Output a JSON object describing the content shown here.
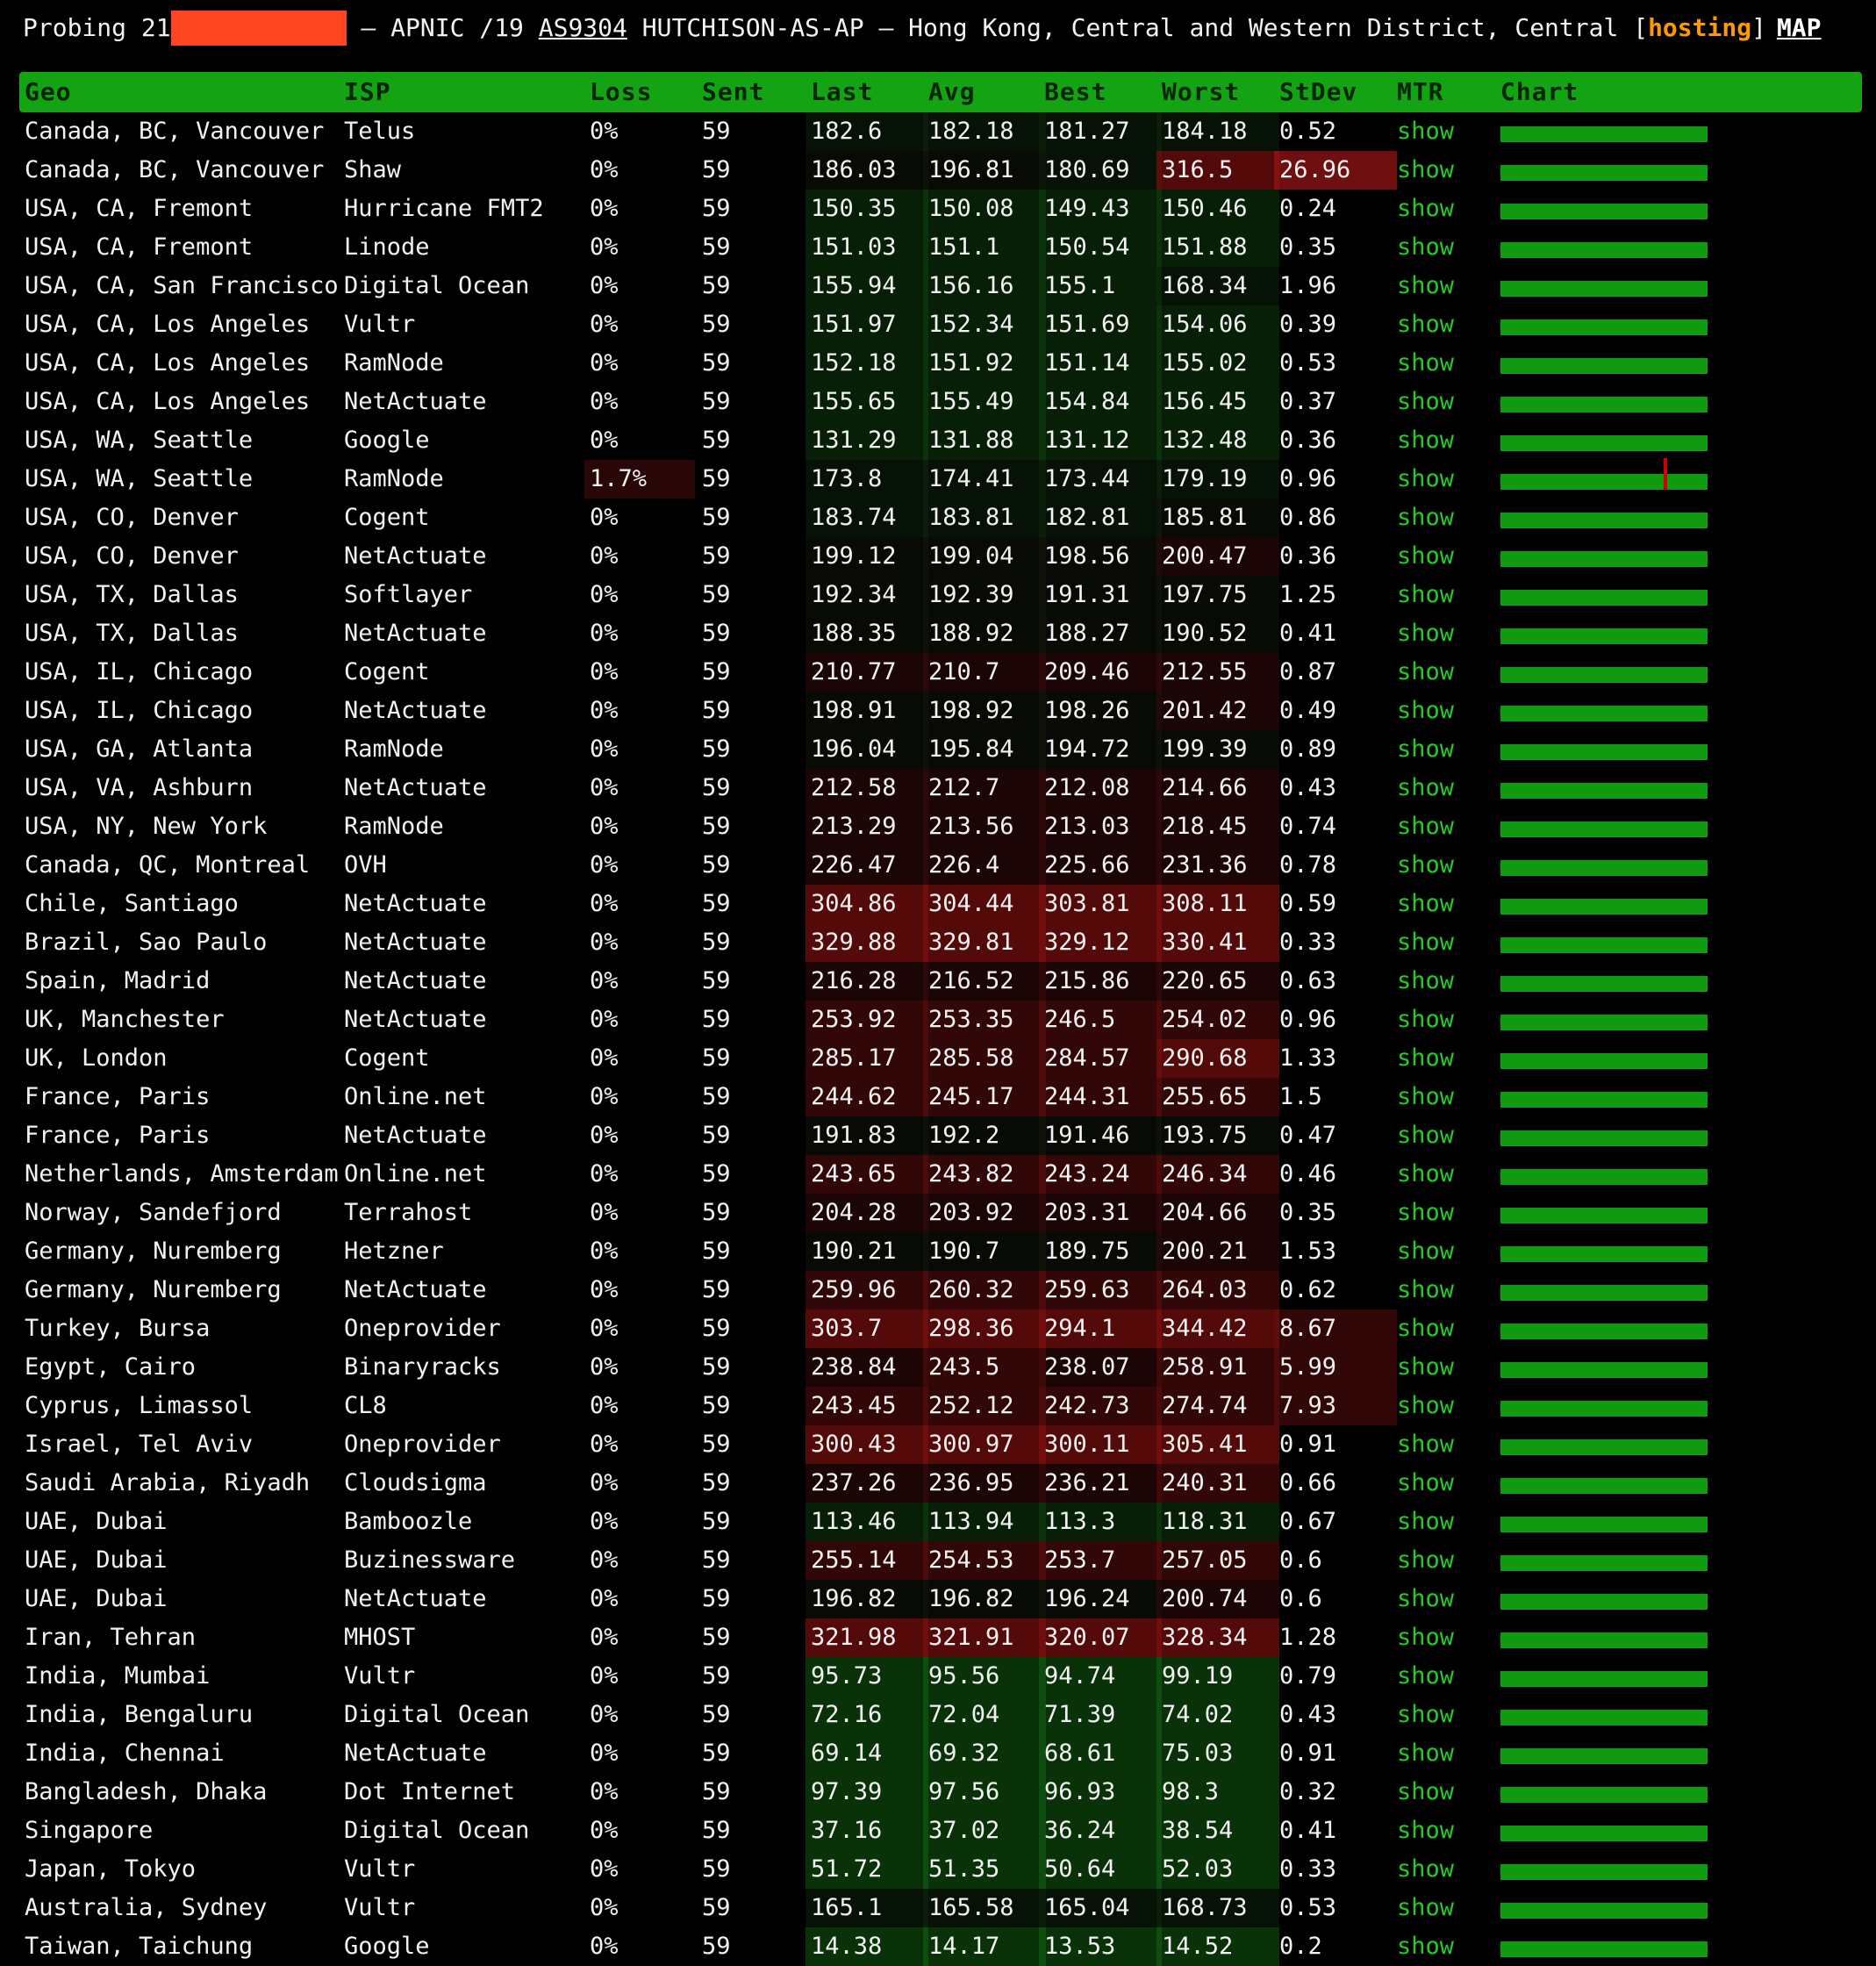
{
  "header": {
    "probing_label": "Probing 21",
    "rest": " – APNIC /19 ",
    "asn": "AS9304",
    "org": " HUTCHISON-AS-AP – Hong Kong, Central and Western District, Central [",
    "tag": "hosting",
    "close": "]",
    "map_label": "MAP"
  },
  "columns": [
    "Geo",
    "ISP",
    "Loss",
    "Sent",
    "Last",
    "Avg",
    "Best",
    "Worst",
    "StDev",
    "MTR",
    "Chart"
  ],
  "rows": [
    {
      "geo": "Canada, BC, Vancouver",
      "isp": "Telus",
      "loss": "0%",
      "sent": "59",
      "last": "182.6",
      "avg": "182.18",
      "best": "181.27",
      "worst": "184.18",
      "stdev": "0.52",
      "mtr": "show"
    },
    {
      "geo": "Canada, BC, Vancouver",
      "isp": "Shaw",
      "loss": "0%",
      "sent": "59",
      "last": "186.03",
      "avg": "196.81",
      "best": "180.69",
      "worst": "316.5",
      "stdev": "26.96",
      "mtr": "show"
    },
    {
      "geo": "USA, CA, Fremont",
      "isp": "Hurricane FMT2",
      "loss": "0%",
      "sent": "59",
      "last": "150.35",
      "avg": "150.08",
      "best": "149.43",
      "worst": "150.46",
      "stdev": "0.24",
      "mtr": "show"
    },
    {
      "geo": "USA, CA, Fremont",
      "isp": "Linode",
      "loss": "0%",
      "sent": "59",
      "last": "151.03",
      "avg": "151.1",
      "best": "150.54",
      "worst": "151.88",
      "stdev": "0.35",
      "mtr": "show"
    },
    {
      "geo": "USA, CA, San Francisco",
      "isp": "Digital Ocean",
      "loss": "0%",
      "sent": "59",
      "last": "155.94",
      "avg": "156.16",
      "best": "155.1",
      "worst": "168.34",
      "stdev": "1.96",
      "mtr": "show"
    },
    {
      "geo": "USA, CA, Los Angeles",
      "isp": "Vultr",
      "loss": "0%",
      "sent": "59",
      "last": "151.97",
      "avg": "152.34",
      "best": "151.69",
      "worst": "154.06",
      "stdev": "0.39",
      "mtr": "show"
    },
    {
      "geo": "USA, CA, Los Angeles",
      "isp": "RamNode",
      "loss": "0%",
      "sent": "59",
      "last": "152.18",
      "avg": "151.92",
      "best": "151.14",
      "worst": "155.02",
      "stdev": "0.53",
      "mtr": "show"
    },
    {
      "geo": "USA, CA, Los Angeles",
      "isp": "NetActuate",
      "loss": "0%",
      "sent": "59",
      "last": "155.65",
      "avg": "155.49",
      "best": "154.84",
      "worst": "156.45",
      "stdev": "0.37",
      "mtr": "show"
    },
    {
      "geo": "USA, WA, Seattle",
      "isp": "Google",
      "loss": "0%",
      "sent": "59",
      "last": "131.29",
      "avg": "131.88",
      "best": "131.12",
      "worst": "132.48",
      "stdev": "0.36",
      "mtr": "show"
    },
    {
      "geo": "USA, WA, Seattle",
      "isp": "RamNode",
      "loss": "1.7%",
      "sent": "59",
      "last": "173.8",
      "avg": "174.41",
      "best": "173.44",
      "worst": "179.19",
      "stdev": "0.96",
      "mtr": "show",
      "spike": 0.79
    },
    {
      "geo": "USA, CO, Denver",
      "isp": "Cogent",
      "loss": "0%",
      "sent": "59",
      "last": "183.74",
      "avg": "183.81",
      "best": "182.81",
      "worst": "185.81",
      "stdev": "0.86",
      "mtr": "show"
    },
    {
      "geo": "USA, CO, Denver",
      "isp": "NetActuate",
      "loss": "0%",
      "sent": "59",
      "last": "199.12",
      "avg": "199.04",
      "best": "198.56",
      "worst": "200.47",
      "stdev": "0.36",
      "mtr": "show"
    },
    {
      "geo": "USA, TX, Dallas",
      "isp": "Softlayer",
      "loss": "0%",
      "sent": "59",
      "last": "192.34",
      "avg": "192.39",
      "best": "191.31",
      "worst": "197.75",
      "stdev": "1.25",
      "mtr": "show"
    },
    {
      "geo": "USA, TX, Dallas",
      "isp": "NetActuate",
      "loss": "0%",
      "sent": "59",
      "last": "188.35",
      "avg": "188.92",
      "best": "188.27",
      "worst": "190.52",
      "stdev": "0.41",
      "mtr": "show"
    },
    {
      "geo": "USA, IL, Chicago",
      "isp": "Cogent",
      "loss": "0%",
      "sent": "59",
      "last": "210.77",
      "avg": "210.7",
      "best": "209.46",
      "worst": "212.55",
      "stdev": "0.87",
      "mtr": "show"
    },
    {
      "geo": "USA, IL, Chicago",
      "isp": "NetActuate",
      "loss": "0%",
      "sent": "59",
      "last": "198.91",
      "avg": "198.92",
      "best": "198.26",
      "worst": "201.42",
      "stdev": "0.49",
      "mtr": "show"
    },
    {
      "geo": "USA, GA, Atlanta",
      "isp": "RamNode",
      "loss": "0%",
      "sent": "59",
      "last": "196.04",
      "avg": "195.84",
      "best": "194.72",
      "worst": "199.39",
      "stdev": "0.89",
      "mtr": "show"
    },
    {
      "geo": "USA, VA, Ashburn",
      "isp": "NetActuate",
      "loss": "0%",
      "sent": "59",
      "last": "212.58",
      "avg": "212.7",
      "best": "212.08",
      "worst": "214.66",
      "stdev": "0.43",
      "mtr": "show"
    },
    {
      "geo": "USA, NY, New York",
      "isp": "RamNode",
      "loss": "0%",
      "sent": "59",
      "last": "213.29",
      "avg": "213.56",
      "best": "213.03",
      "worst": "218.45",
      "stdev": "0.74",
      "mtr": "show"
    },
    {
      "geo": "Canada, QC, Montreal",
      "isp": "OVH",
      "loss": "0%",
      "sent": "59",
      "last": "226.47",
      "avg": "226.4",
      "best": "225.66",
      "worst": "231.36",
      "stdev": "0.78",
      "mtr": "show"
    },
    {
      "geo": "Chile, Santiago",
      "isp": "NetActuate",
      "loss": "0%",
      "sent": "59",
      "last": "304.86",
      "avg": "304.44",
      "best": "303.81",
      "worst": "308.11",
      "stdev": "0.59",
      "mtr": "show"
    },
    {
      "geo": "Brazil, Sao Paulo",
      "isp": "NetActuate",
      "loss": "0%",
      "sent": "59",
      "last": "329.88",
      "avg": "329.81",
      "best": "329.12",
      "worst": "330.41",
      "stdev": "0.33",
      "mtr": "show"
    },
    {
      "geo": "Spain, Madrid",
      "isp": "NetActuate",
      "loss": "0%",
      "sent": "59",
      "last": "216.28",
      "avg": "216.52",
      "best": "215.86",
      "worst": "220.65",
      "stdev": "0.63",
      "mtr": "show"
    },
    {
      "geo": "UK, Manchester",
      "isp": "NetActuate",
      "loss": "0%",
      "sent": "59",
      "last": "253.92",
      "avg": "253.35",
      "best": "246.5",
      "worst": "254.02",
      "stdev": "0.96",
      "mtr": "show"
    },
    {
      "geo": "UK, London",
      "isp": "Cogent",
      "loss": "0%",
      "sent": "59",
      "last": "285.17",
      "avg": "285.58",
      "best": "284.57",
      "worst": "290.68",
      "stdev": "1.33",
      "mtr": "show"
    },
    {
      "geo": "France, Paris",
      "isp": "Online.net",
      "loss": "0%",
      "sent": "59",
      "last": "244.62",
      "avg": "245.17",
      "best": "244.31",
      "worst": "255.65",
      "stdev": "1.5",
      "mtr": "show"
    },
    {
      "geo": "France, Paris",
      "isp": "NetActuate",
      "loss": "0%",
      "sent": "59",
      "last": "191.83",
      "avg": "192.2",
      "best": "191.46",
      "worst": "193.75",
      "stdev": "0.47",
      "mtr": "show"
    },
    {
      "geo": "Netherlands, Amsterdam",
      "isp": "Online.net",
      "loss": "0%",
      "sent": "59",
      "last": "243.65",
      "avg": "243.82",
      "best": "243.24",
      "worst": "246.34",
      "stdev": "0.46",
      "mtr": "show"
    },
    {
      "geo": "Norway, Sandefjord",
      "isp": "Terrahost",
      "loss": "0%",
      "sent": "59",
      "last": "204.28",
      "avg": "203.92",
      "best": "203.31",
      "worst": "204.66",
      "stdev": "0.35",
      "mtr": "show"
    },
    {
      "geo": "Germany, Nuremberg",
      "isp": "Hetzner",
      "loss": "0%",
      "sent": "59",
      "last": "190.21",
      "avg": "190.7",
      "best": "189.75",
      "worst": "200.21",
      "stdev": "1.53",
      "mtr": "show"
    },
    {
      "geo": "Germany, Nuremberg",
      "isp": "NetActuate",
      "loss": "0%",
      "sent": "59",
      "last": "259.96",
      "avg": "260.32",
      "best": "259.63",
      "worst": "264.03",
      "stdev": "0.62",
      "mtr": "show"
    },
    {
      "geo": "Turkey, Bursa",
      "isp": "Oneprovider",
      "loss": "0%",
      "sent": "59",
      "last": "303.7",
      "avg": "298.36",
      "best": "294.1",
      "worst": "344.42",
      "stdev": "8.67",
      "mtr": "show"
    },
    {
      "geo": "Egypt, Cairo",
      "isp": "Binaryracks",
      "loss": "0%",
      "sent": "59",
      "last": "238.84",
      "avg": "243.5",
      "best": "238.07",
      "worst": "258.91",
      "stdev": "5.99",
      "mtr": "show"
    },
    {
      "geo": "Cyprus, Limassol",
      "isp": "CL8",
      "loss": "0%",
      "sent": "59",
      "last": "243.45",
      "avg": "252.12",
      "best": "242.73",
      "worst": "274.74",
      "stdev": "7.93",
      "mtr": "show"
    },
    {
      "geo": "Israel, Tel Aviv",
      "isp": "Oneprovider",
      "loss": "0%",
      "sent": "59",
      "last": "300.43",
      "avg": "300.97",
      "best": "300.11",
      "worst": "305.41",
      "stdev": "0.91",
      "mtr": "show"
    },
    {
      "geo": "Saudi Arabia, Riyadh",
      "isp": "Cloudsigma",
      "loss": "0%",
      "sent": "59",
      "last": "237.26",
      "avg": "236.95",
      "best": "236.21",
      "worst": "240.31",
      "stdev": "0.66",
      "mtr": "show"
    },
    {
      "geo": "UAE, Dubai",
      "isp": "Bamboozle",
      "loss": "0%",
      "sent": "59",
      "last": "113.46",
      "avg": "113.94",
      "best": "113.3",
      "worst": "118.31",
      "stdev": "0.67",
      "mtr": "show"
    },
    {
      "geo": "UAE, Dubai",
      "isp": "Buzinessware",
      "loss": "0%",
      "sent": "59",
      "last": "255.14",
      "avg": "254.53",
      "best": "253.7",
      "worst": "257.05",
      "stdev": "0.6",
      "mtr": "show"
    },
    {
      "geo": "UAE, Dubai",
      "isp": "NetActuate",
      "loss": "0%",
      "sent": "59",
      "last": "196.82",
      "avg": "196.82",
      "best": "196.24",
      "worst": "200.74",
      "stdev": "0.6",
      "mtr": "show"
    },
    {
      "geo": "Iran, Tehran",
      "isp": "MHOST",
      "loss": "0%",
      "sent": "59",
      "last": "321.98",
      "avg": "321.91",
      "best": "320.07",
      "worst": "328.34",
      "stdev": "1.28",
      "mtr": "show"
    },
    {
      "geo": "India, Mumbai",
      "isp": "Vultr",
      "loss": "0%",
      "sent": "59",
      "last": "95.73",
      "avg": "95.56",
      "best": "94.74",
      "worst": "99.19",
      "stdev": "0.79",
      "mtr": "show"
    },
    {
      "geo": "India, Bengaluru",
      "isp": "Digital Ocean",
      "loss": "0%",
      "sent": "59",
      "last": "72.16",
      "avg": "72.04",
      "best": "71.39",
      "worst": "74.02",
      "stdev": "0.43",
      "mtr": "show"
    },
    {
      "geo": "India, Chennai",
      "isp": "NetActuate",
      "loss": "0%",
      "sent": "59",
      "last": "69.14",
      "avg": "69.32",
      "best": "68.61",
      "worst": "75.03",
      "stdev": "0.91",
      "mtr": "show"
    },
    {
      "geo": "Bangladesh, Dhaka",
      "isp": "Dot Internet",
      "loss": "0%",
      "sent": "59",
      "last": "97.39",
      "avg": "97.56",
      "best": "96.93",
      "worst": "98.3",
      "stdev": "0.32",
      "mtr": "show"
    },
    {
      "geo": "Singapore",
      "isp": "Digital Ocean",
      "loss": "0%",
      "sent": "59",
      "last": "37.16",
      "avg": "37.02",
      "best": "36.24",
      "worst": "38.54",
      "stdev": "0.41",
      "mtr": "show"
    },
    {
      "geo": "Japan, Tokyo",
      "isp": "Vultr",
      "loss": "0%",
      "sent": "59",
      "last": "51.72",
      "avg": "51.35",
      "best": "50.64",
      "worst": "52.03",
      "stdev": "0.33",
      "mtr": "show"
    },
    {
      "geo": "Australia, Sydney",
      "isp": "Vultr",
      "loss": "0%",
      "sent": "59",
      "last": "165.1",
      "avg": "165.58",
      "best": "165.04",
      "worst": "168.73",
      "stdev": "0.53",
      "mtr": "show"
    },
    {
      "geo": "Taiwan, Taichung",
      "isp": "Google",
      "loss": "0%",
      "sent": "59",
      "last": "14.38",
      "avg": "14.17",
      "best": "13.53",
      "worst": "14.52",
      "stdev": "0.2",
      "mtr": "show"
    }
  ],
  "colors": {
    "header_bar": "#13a313",
    "good": "#0f3a0f",
    "bad": "#3a0808",
    "mtr_link": "#22cc22",
    "redaction": "#ff4422",
    "hosting_tag": "#ff9900",
    "loss_spike": "#cc0000"
  }
}
